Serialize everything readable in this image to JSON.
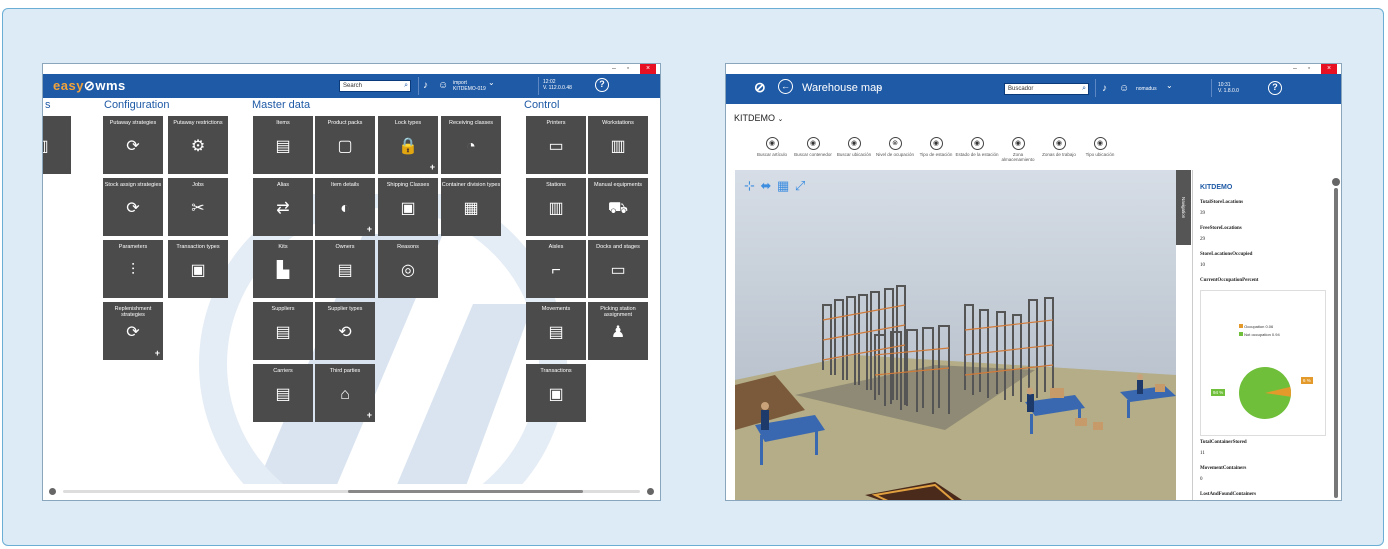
{
  "colors": {
    "brand_blue": "#1f5aa6",
    "tile_gray": "#4b4b4b",
    "accent_orange": "#f2a23a",
    "pie_green": "#6fbf3a",
    "pie_orange": "#e39a2a"
  },
  "left_window": {
    "titlebar": {
      "min": "–",
      "max": "▫",
      "close": "×"
    },
    "logo": {
      "easy": "easy",
      "wms": "wms"
    },
    "search_placeholder": "Search",
    "user_line1": "import",
    "user_line2": "KITDEMO-019",
    "clock_line1": "12:02",
    "clock_line2": "V. 112.0.0.48",
    "sections": {
      "configuration": "Configuration",
      "master_data": "Master data",
      "control": "Control",
      "cut": "s"
    },
    "tiles": [
      {
        "label": "Putaway strategies",
        "icon": "⟳",
        "plus": ""
      },
      {
        "label": "Putaway restrictions",
        "icon": "⚙",
        "plus": ""
      },
      {
        "label": "Stock assign strategies",
        "icon": "⟳",
        "plus": ""
      },
      {
        "label": "Jobs",
        "icon": "✂",
        "plus": ""
      },
      {
        "label": "Parameters",
        "icon": "⫶",
        "plus": ""
      },
      {
        "label": "Transaction types",
        "icon": "▣",
        "plus": ""
      },
      {
        "label": "Replenishment strategies",
        "icon": "⟳",
        "plus": "+"
      },
      {
        "label": "Items",
        "icon": "▤",
        "plus": ""
      },
      {
        "label": "Product packs",
        "icon": "▢",
        "plus": ""
      },
      {
        "label": "Lock types",
        "icon": "🔒",
        "plus": "+"
      },
      {
        "label": "Receiving classes",
        "icon": "◔",
        "plus": ""
      },
      {
        "label": "Alias",
        "icon": "⇄",
        "plus": ""
      },
      {
        "label": "Item details",
        "icon": "◐",
        "plus": "+"
      },
      {
        "label": "Shipping Classes",
        "icon": "▣",
        "plus": ""
      },
      {
        "label": "Container division types",
        "icon": "▦",
        "plus": ""
      },
      {
        "label": "Kits",
        "icon": "▙",
        "plus": ""
      },
      {
        "label": "Owners",
        "icon": "▤",
        "plus": ""
      },
      {
        "label": "Reasons",
        "icon": "◎",
        "plus": ""
      },
      {
        "label": "Suppliers",
        "icon": "▤",
        "plus": ""
      },
      {
        "label": "Supplier types",
        "icon": "⟲",
        "plus": ""
      },
      {
        "label": "Carriers",
        "icon": "▤",
        "plus": ""
      },
      {
        "label": "Third parties",
        "icon": "⌂",
        "plus": "+"
      },
      {
        "label": "Printers",
        "icon": "▭",
        "plus": ""
      },
      {
        "label": "Workstations",
        "icon": "▥",
        "plus": ""
      },
      {
        "label": "Stations",
        "icon": "▥",
        "plus": ""
      },
      {
        "label": "Manual equipments",
        "icon": "⛟",
        "plus": ""
      },
      {
        "label": "Aisles",
        "icon": "⌐",
        "plus": ""
      },
      {
        "label": "Docks and stages",
        "icon": "▭",
        "plus": ""
      },
      {
        "label": "Movements",
        "icon": "▤",
        "plus": ""
      },
      {
        "label": "Picking station assignment",
        "icon": "♟",
        "plus": ""
      },
      {
        "label": "Transactions",
        "icon": "▣",
        "plus": ""
      },
      {
        "label": "ts",
        "icon": "▥",
        "plus": ""
      }
    ]
  },
  "right_window": {
    "titlebar": {
      "min": "–",
      "max": "▫",
      "close": "×"
    },
    "page_title": "Warehouse map",
    "search_placeholder": "Buscador",
    "user": "nomadus",
    "clock_line1": "10:31",
    "clock_line2": "V. 1.8.0.0",
    "crumb": "KITDEMO",
    "tools": [
      {
        "icon": "◉",
        "label": "Buscar artículo"
      },
      {
        "icon": "◉",
        "label": "Buscar contenedor"
      },
      {
        "icon": "◉",
        "label": "Buscar ubicación"
      },
      {
        "icon": "⊗",
        "label": "Nivel de ocupación"
      },
      {
        "icon": "◉",
        "label": "Tipo de estación"
      },
      {
        "icon": "◉",
        "label": "Estado de la estación"
      },
      {
        "icon": "◉",
        "label": "Zona almacenamiento"
      },
      {
        "icon": "◉",
        "label": "Zonas de trabajo"
      },
      {
        "icon": "◉",
        "label": "Tipo ubicación"
      }
    ],
    "nav_tools": "⊹ ⬌ ▦ ⤢",
    "side_tab": "Navigation",
    "panel": {
      "title": "KITDEMO",
      "stats": [
        {
          "key": "TotalStoreLocations",
          "value": "39"
        },
        {
          "key": "FreeStoreLocations",
          "value": "29"
        },
        {
          "key": "StoreLocationsOccupied",
          "value": "10"
        },
        {
          "key": "CurrentOccupationPercent",
          "value": ""
        }
      ],
      "pie": {
        "legend": [
          "Occupation 0.06",
          "Not occupation 0.94"
        ],
        "label_green": "94 %",
        "label_orange": "6 %",
        "values": [
          0.06,
          0.94
        ]
      },
      "stats2": [
        {
          "key": "TotalContainerStored",
          "value": "11"
        },
        {
          "key": "MovementContainers",
          "value": "0"
        },
        {
          "key": "LostAndFoundContainers",
          "value": ""
        }
      ]
    }
  }
}
